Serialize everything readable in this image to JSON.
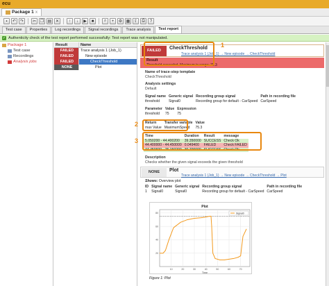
{
  "window": {
    "title": "ecu"
  },
  "doc_tab": {
    "label": "Package 1",
    "close": "x"
  },
  "tabs": [
    {
      "label": "Test case",
      "active": false
    },
    {
      "label": "Properties",
      "active": false
    },
    {
      "label": "Log recordings",
      "active": false
    },
    {
      "label": "Signal recordings",
      "active": false
    },
    {
      "label": "Trace analysis",
      "active": false
    },
    {
      "label": "Test report",
      "active": true
    }
  ],
  "auth_bar": {
    "text": "Authenticity check of the test report performed successfully: Test report was not manipulated."
  },
  "tree": [
    {
      "label": "Package 1",
      "level": 0,
      "color": "#d23a3a"
    },
    {
      "label": "Test case",
      "level": 1,
      "color": "#333333"
    },
    {
      "label": "Recordings",
      "level": 1,
      "color": "#333333"
    },
    {
      "label": "Analysis jobs",
      "level": 1,
      "color": "#d23a3a"
    }
  ],
  "mid_table": {
    "headers": {
      "result": "Result",
      "name": "Name"
    },
    "rows": [
      {
        "result": "FAILED",
        "name": "Trace analysis 1 (Job_1)",
        "kind": "failed",
        "indent": 0
      },
      {
        "result": "FAILED",
        "name": "New episode",
        "kind": "failed",
        "indent": 1
      },
      {
        "result": "FAILED",
        "name": "CheckThreshold",
        "kind": "failed",
        "indent": 2,
        "selected": true
      },
      {
        "result": "NONE",
        "name": "Plot",
        "kind": "none",
        "indent": 3
      }
    ]
  },
  "detail": {
    "status_badge": "FAILED",
    "step_title": "CheckThreshold",
    "breadcrumb": "Trace analysis 1 (Job_1) → New episode → CheckThreshold",
    "result_label": "Result",
    "result_text": "Threshold exceeded. Maximum in range: 75.3",
    "trace_template_label": "Name of trace-step template",
    "trace_template_value": "CheckThreshold",
    "analysis_settings_label": "Analysis settings",
    "analysis_settings_value": "Default",
    "signal_table": {
      "headers": [
        "Signal name",
        "Generic signal",
        "Recording group signal",
        "Path in recording file"
      ],
      "rows": [
        [
          "threshold",
          "Signal0",
          "Recording group for default - CarSpeed",
          "CarSpeed"
        ]
      ]
    },
    "param_table": {
      "headers": [
        "Parameter",
        "Value",
        "Expression"
      ],
      "rows": [
        [
          "threshold",
          "75",
          "75"
        ]
      ]
    },
    "return_table": {
      "headers": [
        "Return",
        "Transfer variable",
        "Value"
      ],
      "rows": [
        [
          "max Value",
          "MaximumSpeed",
          "75.3"
        ]
      ]
    },
    "time_table": {
      "headers": [
        "Time",
        "Duration",
        "Result",
        "message"
      ],
      "rows": [
        {
          "time": "5.050200 - 44.400200",
          "duration": "39.350000",
          "result": "SUCCESS",
          "message": "Check Ok",
          "kind": "success"
        },
        {
          "time": "44.400000 - 44.450000",
          "duration": "0.049400",
          "result": "FAILED",
          "message": "Check FAILED",
          "kind": "failed"
        },
        {
          "time": "44.450600 - 75.150200",
          "duration": "30.700000",
          "result": "SUCCESS",
          "message": "Check Ok",
          "kind": "success"
        }
      ]
    },
    "description_label": "Description",
    "description_value": "Checks whether the given signal exceeds the given threshold",
    "plot_badge": "NONE",
    "plot_title": "Plot",
    "plot_breadcrumb": "Trace analysis 1 (Job_1) → New episode → CheckThreshold → Plot",
    "shows_label": "Shows:",
    "shows_value": "Overview plot",
    "plot_signal_table": {
      "headers": [
        "ID",
        "Signal name",
        "Generic signal",
        "Recording group signal",
        "Path in recording file"
      ],
      "rows": [
        [
          "1",
          "Signal0",
          "Signal0",
          "Recording group for default - CarSpeed",
          "CarSpeed"
        ]
      ]
    },
    "figure_caption": "Figure 1: Plot",
    "markers": [
      "1",
      "2",
      "3"
    ]
  },
  "chart_data": {
    "type": "line",
    "title": "Plot",
    "xlabel": "Time",
    "ylabel": "",
    "legend": "top-right",
    "grid": true,
    "colors": {
      "line": "#f39a1e",
      "threshold": "#444444"
    },
    "series": [
      {
        "name": "Signal0",
        "x": [
          0,
          3,
          5,
          8,
          12,
          18,
          24,
          30,
          36,
          40,
          43,
          44.4,
          45,
          46,
          48,
          52,
          56,
          60,
          64,
          68,
          70,
          72,
          75
        ],
        "values": [
          20,
          20,
          24,
          40,
          58,
          66,
          70,
          72,
          73,
          74,
          75.1,
          75.3,
          60,
          20,
          12,
          10,
          10,
          11,
          12,
          14,
          16,
          45,
          56
        ]
      }
    ],
    "threshold": 75,
    "xlim": [
      0,
      78
    ],
    "ylim": [
      0,
      85
    ]
  }
}
